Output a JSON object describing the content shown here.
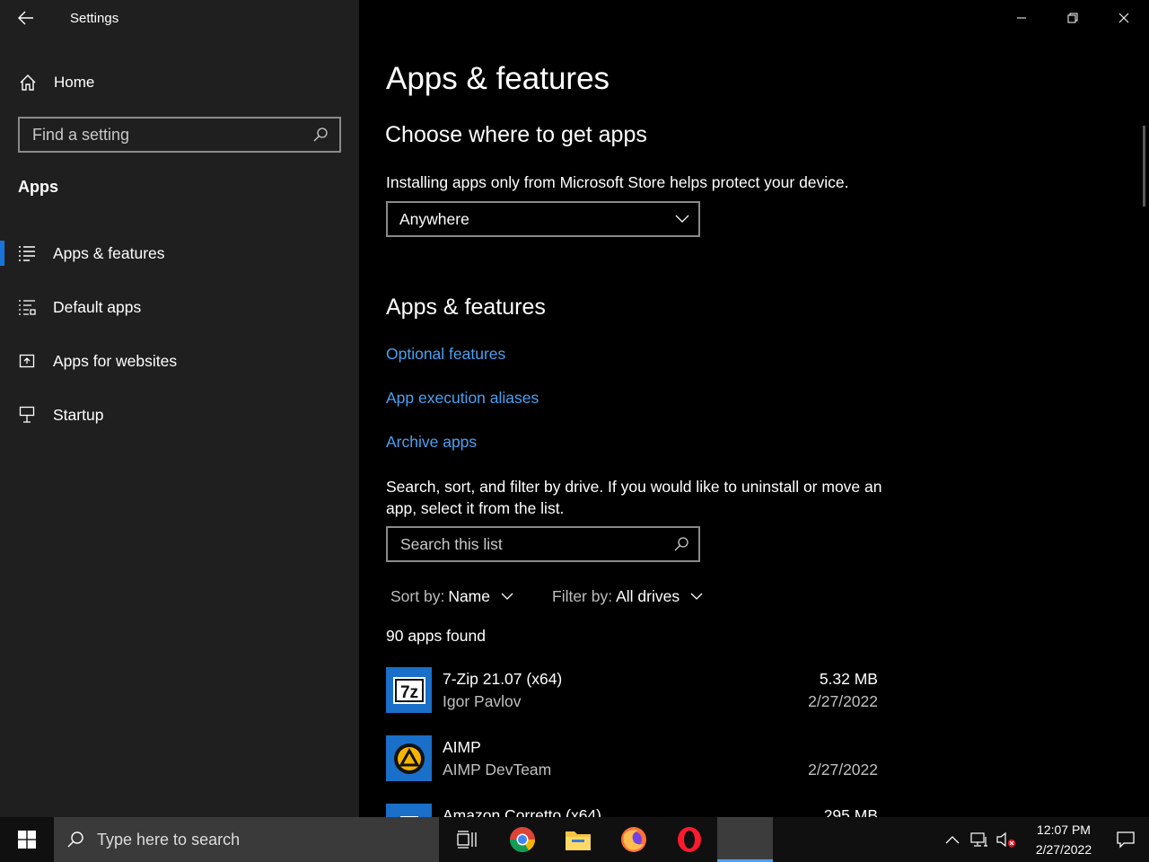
{
  "window": {
    "title": "Settings"
  },
  "sidebar": {
    "home_label": "Home",
    "search_placeholder": "Find a setting",
    "section_label": "Apps",
    "items": [
      {
        "label": "Apps & features",
        "active": true
      },
      {
        "label": "Default apps"
      },
      {
        "label": "Apps for websites"
      },
      {
        "label": "Startup"
      }
    ]
  },
  "main": {
    "title": "Apps & features",
    "choose": {
      "heading": "Choose where to get apps",
      "description": "Installing apps only from Microsoft Store helps protect your device.",
      "dropdown_value": "Anywhere"
    },
    "features": {
      "heading": "Apps & features",
      "links": [
        "Optional features",
        "App execution aliases",
        "Archive apps"
      ],
      "description": "Search, sort, and filter by drive. If you would like to uninstall or move an app, select it from the list.",
      "search_placeholder": "Search this list",
      "sort_label": "Sort by:",
      "sort_value": "Name",
      "filter_label": "Filter by:",
      "filter_value": "All drives",
      "count": "90 apps found"
    },
    "apps": [
      {
        "name": "7-Zip 21.07 (x64)",
        "publisher": "Igor Pavlov",
        "size": "5.32 MB",
        "date": "2/27/2022"
      },
      {
        "name": "AIMP",
        "publisher": "AIMP DevTeam",
        "size": "",
        "date": "2/27/2022"
      },
      {
        "name": "Amazon Corretto (x64)",
        "publisher": "",
        "size": "295 MB",
        "date": ""
      }
    ]
  },
  "taskbar": {
    "search_placeholder": "Type here to search",
    "time": "12:07 PM",
    "date": "2/27/2022"
  },
  "colors": {
    "accent": "#1a73d9",
    "link": "#4ca0f0",
    "sidebar_bg": "#1f1f1f"
  }
}
